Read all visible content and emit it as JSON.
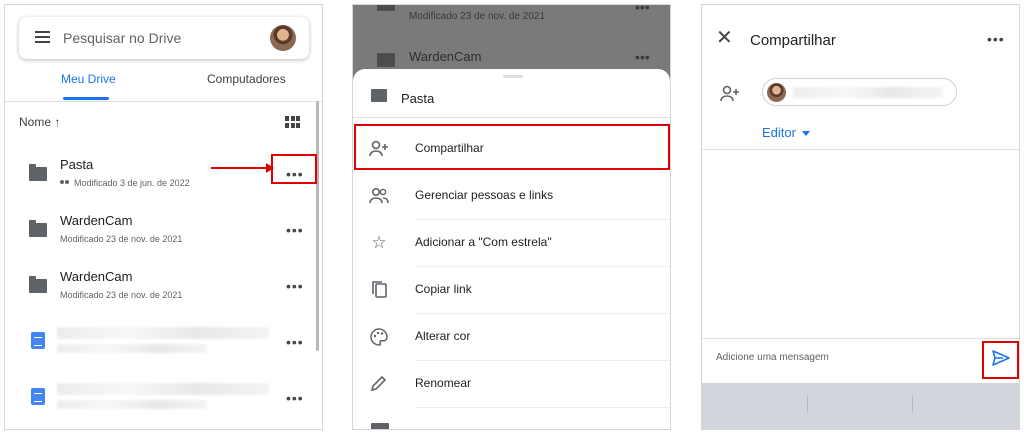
{
  "panel1": {
    "search_placeholder": "Pesquisar no Drive",
    "tabs": [
      "Meu Drive",
      "Computadores"
    ],
    "sort_label": "Nome ↑",
    "files": [
      {
        "name": "Pasta",
        "meta": "Modificado 3 de jun. de 2022",
        "type": "folder",
        "shared": true
      },
      {
        "name": "WardenCam",
        "meta": "Modificado 23 de nov. de 2021",
        "type": "folder"
      },
      {
        "name": "WardenCam",
        "meta": "Modificado 23 de nov. de 2021",
        "type": "folder"
      },
      {
        "name": "",
        "meta": "",
        "type": "doc"
      },
      {
        "name": "",
        "meta": "",
        "type": "doc"
      }
    ],
    "more_glyph": "•••"
  },
  "panel2": {
    "background": {
      "top_meta": "Modificado 23 de nov. de 2021",
      "item_name": "WardenCam",
      "more_glyph": "•••"
    },
    "sheet_title": "Pasta",
    "menu": [
      {
        "label": "Compartilhar",
        "icon": "person-add-icon"
      },
      {
        "label": "Gerenciar pessoas e links",
        "icon": "people-icon"
      },
      {
        "label": "Adicionar a \"Com estrela\"",
        "icon": "star-icon"
      },
      {
        "label": "Copiar link",
        "icon": "copy-icon"
      },
      {
        "label": "Alterar cor",
        "icon": "palette-icon"
      },
      {
        "label": "Renomear",
        "icon": "pencil-icon"
      }
    ]
  },
  "panel3": {
    "title": "Compartilhar",
    "role": "Editor",
    "message_placeholder": "Adicione uma mensagem",
    "more_glyph": "•••",
    "close_glyph": "✕"
  },
  "colors": {
    "accent": "#1a73e8",
    "highlight": "#e00000",
    "doc": "#4285f4"
  }
}
